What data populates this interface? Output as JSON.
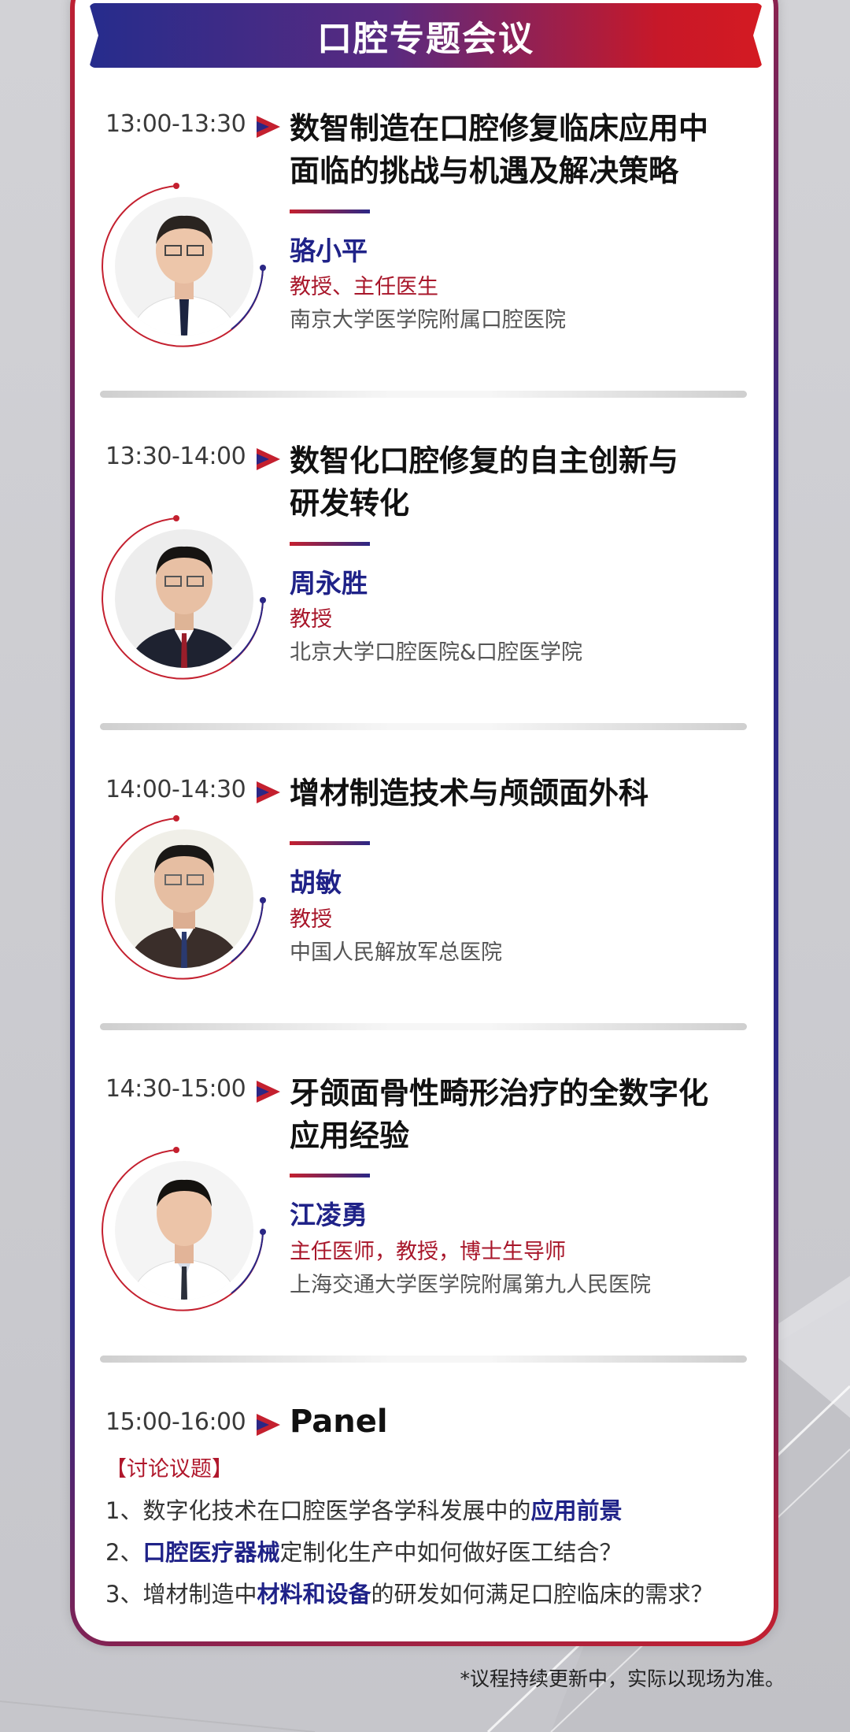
{
  "header": {
    "title": "口腔专题会议"
  },
  "sessions": [
    {
      "time": "13:00-13:30",
      "title_line1": "数智制造在口腔修复临床应用中",
      "title_line2": "面临的挑战与机遇及解决策略",
      "speaker": {
        "name": "骆小平",
        "role": "教授、主任医生",
        "org": "南京大学医学院附属口腔医院"
      }
    },
    {
      "time": "13:30-14:00",
      "title_line1": "数智化口腔修复的自主创新与",
      "title_line2": "研发转化",
      "speaker": {
        "name": "周永胜",
        "role": "教授",
        "org": "北京大学口腔医院&口腔医学院"
      }
    },
    {
      "time": "14:00-14:30",
      "title_line1": "增材制造技术与颅颌面外科",
      "title_line2": "",
      "speaker": {
        "name": "胡敏",
        "role": "教授",
        "org": "中国人民解放军总医院"
      }
    },
    {
      "time": "14:30-15:00",
      "title_line1": "牙颌面骨性畸形治疗的全数字化",
      "title_line2": "应用经验",
      "speaker": {
        "name": "江凌勇",
        "role": "主任医师，教授，博士生导师",
        "org": "上海交通大学医学院附属第九人民医院"
      }
    }
  ],
  "panel": {
    "time": "15:00-16:00",
    "title": "Panel",
    "topics_label": "【讨论议题】",
    "topics": [
      {
        "prefix": "1、数字化技术在口腔医学各学科发展中的",
        "highlight": "应用前景",
        "suffix": ""
      },
      {
        "prefix": "2、",
        "highlight": "口腔医疗器械",
        "suffix": "定制化生产中如何做好医工结合？"
      },
      {
        "prefix": "3、增材制造中",
        "highlight": "材料和设备",
        "suffix": "的研发如何满足口腔临床的需求？"
      }
    ]
  },
  "footnote": "*议程持续更新中，实际以现场为准。",
  "colors": {
    "navy": "#1f2288",
    "red": "#c4202f",
    "role_red": "#a8162a"
  }
}
